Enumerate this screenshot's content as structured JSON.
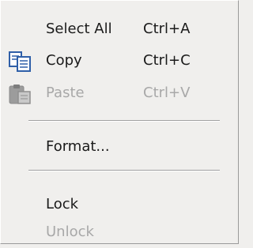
{
  "menu": {
    "items": [
      {
        "label": "Select All",
        "shortcut": "Ctrl+A",
        "enabled": true,
        "icon": null
      },
      {
        "label": "Copy",
        "shortcut": "Ctrl+C",
        "enabled": true,
        "icon": "copy-icon"
      },
      {
        "label": "Paste",
        "shortcut": "Ctrl+V",
        "enabled": false,
        "icon": "paste-icon"
      },
      {
        "label": "Format...",
        "shortcut": "",
        "enabled": true,
        "icon": null
      },
      {
        "label": "Lock",
        "shortcut": "",
        "enabled": true,
        "icon": null
      },
      {
        "label": "Unlock",
        "shortcut": "",
        "enabled": false,
        "icon": null
      }
    ]
  },
  "colors": {
    "background": "#f0efed",
    "text": "#1a1a1a",
    "disabled_text": "#a8a8a8",
    "separator_dark": "#a0a0a0",
    "copy_icon_blue": "#2f5fa8"
  }
}
